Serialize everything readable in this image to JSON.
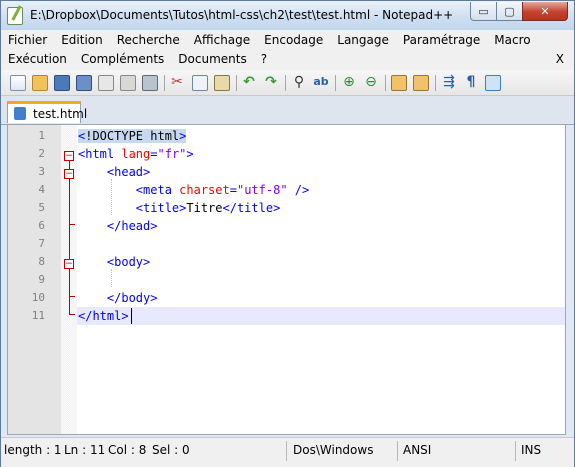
{
  "window": {
    "title": "E:\\Dropbox\\Documents\\Tutos\\html-css\\ch2\\test\\test.html - Notepad++",
    "minimize_glyph": "▭",
    "maximize_glyph": "▢",
    "close_glyph": "✕"
  },
  "menu": {
    "row1": [
      "Fichier",
      "Edition",
      "Recherche",
      "Affichage",
      "Encodage",
      "Langage",
      "Paramétrage",
      "Macro"
    ],
    "row2": [
      "Exécution",
      "Compléments",
      "Documents",
      "?"
    ],
    "close_label": "X"
  },
  "toolbar": {
    "icons": [
      "new-file",
      "open-file",
      "save",
      "save-all",
      "close",
      "close-all",
      "print",
      "cut",
      "copy",
      "paste",
      "undo",
      "redo",
      "find",
      "replace",
      "zoom-in",
      "zoom-out",
      "sync-vertical",
      "sync-horizontal",
      "word-wrap",
      "show-all-chars",
      "indent-guide"
    ]
  },
  "tabs": [
    {
      "label": "test.html"
    }
  ],
  "editor": {
    "lines": [
      {
        "num": "1",
        "html": "<span class=\"hl\"><span class=\"tag\">&lt;</span>!DOCTYPE html<span class=\"tag\">&gt;</span></span>"
      },
      {
        "num": "2",
        "html": "<span class=\"tag\">&lt;html </span><span class=\"attr\">lang</span><span class=\"tag\">=</span><span class=\"str\">\"fr\"</span><span class=\"tag\">&gt;</span>"
      },
      {
        "num": "3",
        "html": "    <span class=\"tag\">&lt;head&gt;</span>"
      },
      {
        "num": "4",
        "html": "        <span class=\"tag\">&lt;meta </span><span class=\"attr\">charset</span><span class=\"tag\">=</span><span class=\"str\">\"utf-8\"</span><span class=\"tag\"> /&gt;</span>"
      },
      {
        "num": "5",
        "html": "        <span class=\"tag\">&lt;title&gt;</span>Titre<span class=\"tag\">&lt;/title&gt;</span>"
      },
      {
        "num": "6",
        "html": "    <span class=\"tag\">&lt;/head&gt;</span>"
      },
      {
        "num": "7",
        "html": ""
      },
      {
        "num": "8",
        "html": "    <span class=\"tag\">&lt;body&gt;</span>"
      },
      {
        "num": "9",
        "html": ""
      },
      {
        "num": "10",
        "html": "    <span class=\"tag\">&lt;/body&gt;</span>"
      },
      {
        "num": "11",
        "html": "<span class=\"tag\">&lt;/html&gt;</span>"
      }
    ]
  },
  "status": {
    "length": "length : 1",
    "ln": "Ln : 11",
    "col": "Col : 8",
    "sel": "Sel : 0",
    "eol": "Dos\\Windows",
    "encoding": "ANSI",
    "mode": "INS"
  }
}
